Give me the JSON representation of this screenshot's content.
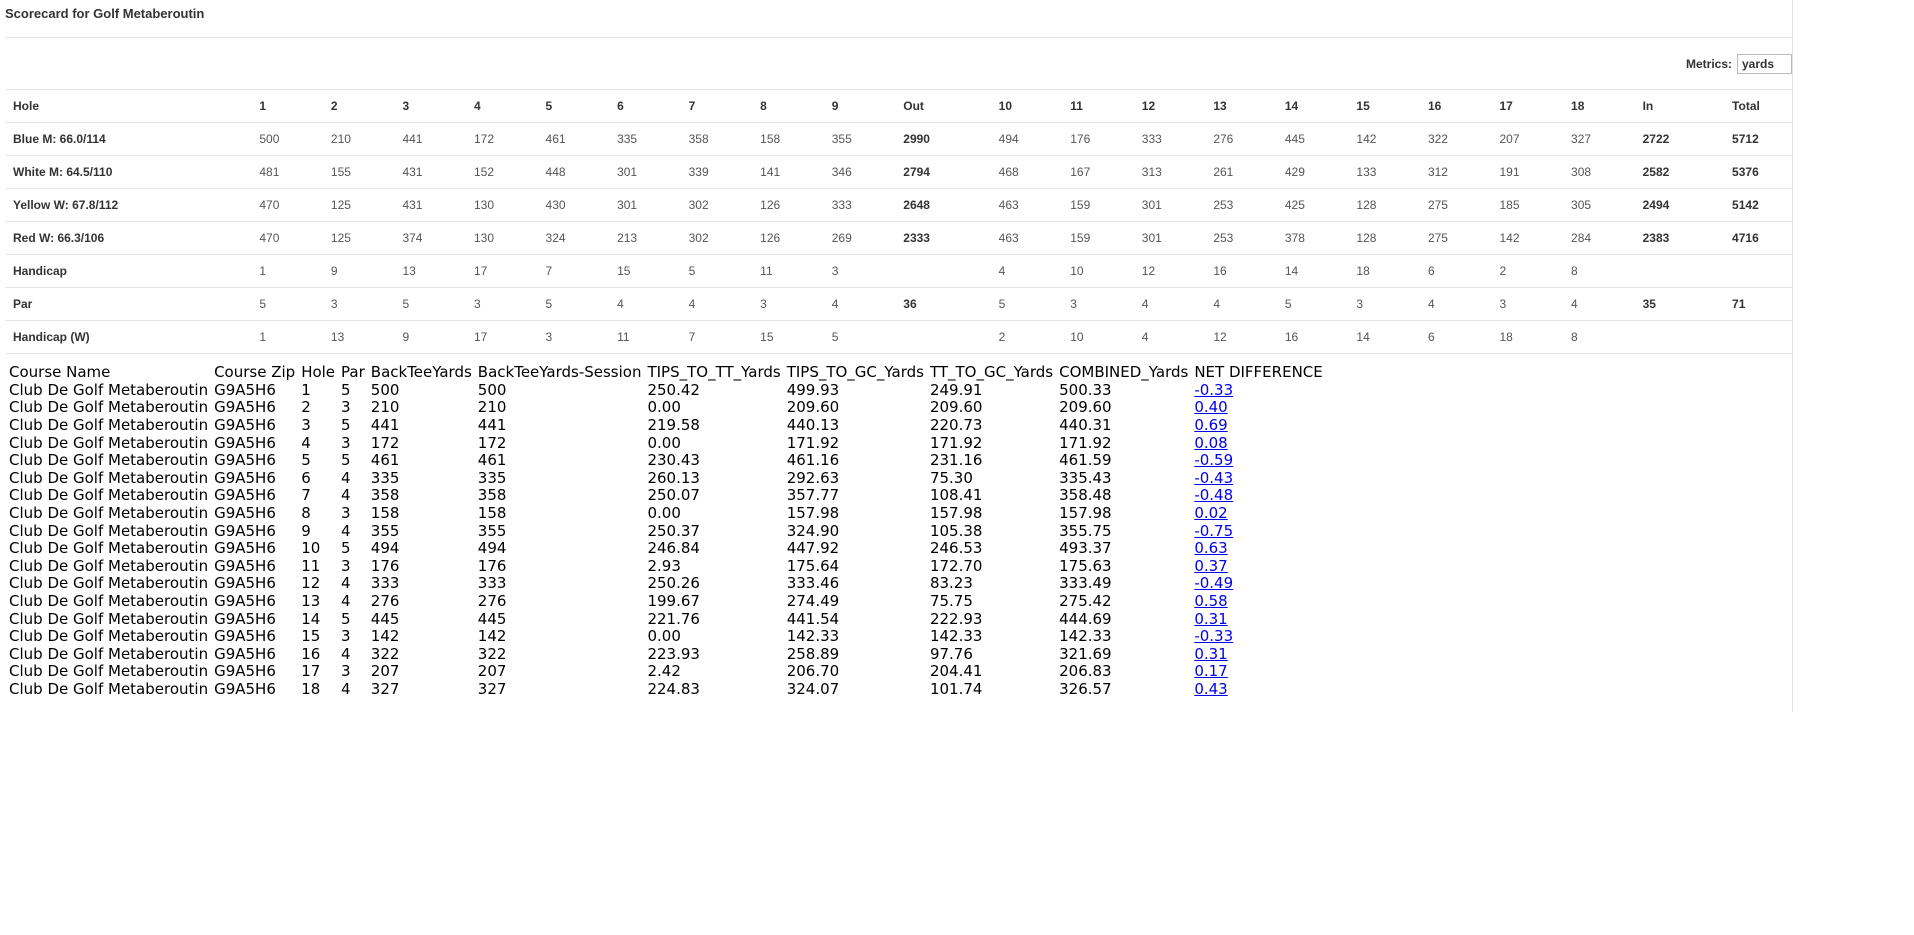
{
  "title": "Scorecard for Golf Metaberoutin",
  "metrics": {
    "label": "Metrics:",
    "value": "yards"
  },
  "scorecard": {
    "header": [
      "Hole",
      "1",
      "2",
      "3",
      "4",
      "5",
      "6",
      "7",
      "8",
      "9",
      "Out",
      "10",
      "11",
      "12",
      "13",
      "14",
      "15",
      "16",
      "17",
      "18",
      "In",
      "Total"
    ],
    "rows": [
      [
        "Blue M: 66.0/114",
        "500",
        "210",
        "441",
        "172",
        "461",
        "335",
        "358",
        "158",
        "355",
        "2990",
        "494",
        "176",
        "333",
        "276",
        "445",
        "142",
        "322",
        "207",
        "327",
        "2722",
        "5712"
      ],
      [
        "White M: 64.5/110",
        "481",
        "155",
        "431",
        "152",
        "448",
        "301",
        "339",
        "141",
        "346",
        "2794",
        "468",
        "167",
        "313",
        "261",
        "429",
        "133",
        "312",
        "191",
        "308",
        "2582",
        "5376"
      ],
      [
        "Yellow W: 67.8/112",
        "470",
        "125",
        "431",
        "130",
        "430",
        "301",
        "302",
        "126",
        "333",
        "2648",
        "463",
        "159",
        "301",
        "253",
        "425",
        "128",
        "275",
        "185",
        "305",
        "2494",
        "5142"
      ],
      [
        "Red W: 66.3/106",
        "470",
        "125",
        "374",
        "130",
        "324",
        "213",
        "302",
        "126",
        "269",
        "2333",
        "463",
        "159",
        "301",
        "253",
        "378",
        "128",
        "275",
        "142",
        "284",
        "2383",
        "4716"
      ],
      [
        "Handicap",
        "1",
        "9",
        "13",
        "17",
        "7",
        "15",
        "5",
        "11",
        "3",
        "",
        "4",
        "10",
        "12",
        "16",
        "14",
        "18",
        "6",
        "2",
        "8",
        "",
        ""
      ],
      [
        "Par",
        "5",
        "3",
        "5",
        "3",
        "5",
        "4",
        "4",
        "3",
        "4",
        "36",
        "5",
        "3",
        "4",
        "4",
        "5",
        "3",
        "4",
        "3",
        "4",
        "35",
        "71"
      ],
      [
        "Handicap (W)",
        "1",
        "13",
        "9",
        "17",
        "3",
        "11",
        "7",
        "15",
        "5",
        "",
        "2",
        "10",
        "4",
        "12",
        "16",
        "14",
        "6",
        "18",
        "8",
        "",
        ""
      ]
    ]
  },
  "data_table": {
    "header": [
      "Course Name",
      "Course Zip",
      "Hole",
      "Par",
      "BackTeeYards",
      "BackTeeYards-Session",
      "TIPS_TO_TT_Yards",
      "TIPS_TO_GC_Yards",
      "TT_TO_GC_Yards",
      "COMBINED_Yards",
      "NET DIFFERENCE"
    ],
    "rows": [
      [
        "Club De Golf Metaberoutin",
        "G9A5H6",
        "1",
        "5",
        "500",
        "500",
        "250.42",
        "499.93",
        "249.91",
        "500.33",
        "-0.33"
      ],
      [
        "Club De Golf Metaberoutin",
        "G9A5H6",
        "2",
        "3",
        "210",
        "210",
        "0.00",
        "209.60",
        "209.60",
        "209.60",
        "0.40"
      ],
      [
        "Club De Golf Metaberoutin",
        "G9A5H6",
        "3",
        "5",
        "441",
        "441",
        "219.58",
        "440.13",
        "220.73",
        "440.31",
        "0.69"
      ],
      [
        "Club De Golf Metaberoutin",
        "G9A5H6",
        "4",
        "3",
        "172",
        "172",
        "0.00",
        "171.92",
        "171.92",
        "171.92",
        "0.08"
      ],
      [
        "Club De Golf Metaberoutin",
        "G9A5H6",
        "5",
        "5",
        "461",
        "461",
        "230.43",
        "461.16",
        "231.16",
        "461.59",
        "-0.59"
      ],
      [
        "Club De Golf Metaberoutin",
        "G9A5H6",
        "6",
        "4",
        "335",
        "335",
        "260.13",
        "292.63",
        "75.30",
        "335.43",
        "-0.43"
      ],
      [
        "Club De Golf Metaberoutin",
        "G9A5H6",
        "7",
        "4",
        "358",
        "358",
        "250.07",
        "357.77",
        "108.41",
        "358.48",
        "-0.48"
      ],
      [
        "Club De Golf Metaberoutin",
        "G9A5H6",
        "8",
        "3",
        "158",
        "158",
        "0.00",
        "157.98",
        "157.98",
        "157.98",
        "0.02"
      ],
      [
        "Club De Golf Metaberoutin",
        "G9A5H6",
        "9",
        "4",
        "355",
        "355",
        "250.37",
        "324.90",
        "105.38",
        "355.75",
        "-0.75"
      ],
      [
        "Club De Golf Metaberoutin",
        "G9A5H6",
        "10",
        "5",
        "494",
        "494",
        "246.84",
        "447.92",
        "246.53",
        "493.37",
        "0.63"
      ],
      [
        "Club De Golf Metaberoutin",
        "G9A5H6",
        "11",
        "3",
        "176",
        "176",
        "2.93",
        "175.64",
        "172.70",
        "175.63",
        "0.37"
      ],
      [
        "Club De Golf Metaberoutin",
        "G9A5H6",
        "12",
        "4",
        "333",
        "333",
        "250.26",
        "333.46",
        "83.23",
        "333.49",
        "-0.49"
      ],
      [
        "Club De Golf Metaberoutin",
        "G9A5H6",
        "13",
        "4",
        "276",
        "276",
        "199.67",
        "274.49",
        "75.75",
        "275.42",
        "0.58"
      ],
      [
        "Club De Golf Metaberoutin",
        "G9A5H6",
        "14",
        "5",
        "445",
        "445",
        "221.76",
        "441.54",
        "222.93",
        "444.69",
        "0.31"
      ],
      [
        "Club De Golf Metaberoutin",
        "G9A5H6",
        "15",
        "3",
        "142",
        "142",
        "0.00",
        "142.33",
        "142.33",
        "142.33",
        "-0.33"
      ],
      [
        "Club De Golf Metaberoutin",
        "G9A5H6",
        "16",
        "4",
        "322",
        "322",
        "223.93",
        "258.89",
        "97.76",
        "321.69",
        "0.31"
      ],
      [
        "Club De Golf Metaberoutin",
        "G9A5H6",
        "17",
        "3",
        "207",
        "207",
        "2.42",
        "206.70",
        "204.41",
        "206.83",
        "0.17"
      ],
      [
        "Club De Golf Metaberoutin",
        "G9A5H6",
        "18",
        "4",
        "327",
        "327",
        "224.83",
        "324.07",
        "101.74",
        "326.57",
        "0.43"
      ]
    ]
  }
}
